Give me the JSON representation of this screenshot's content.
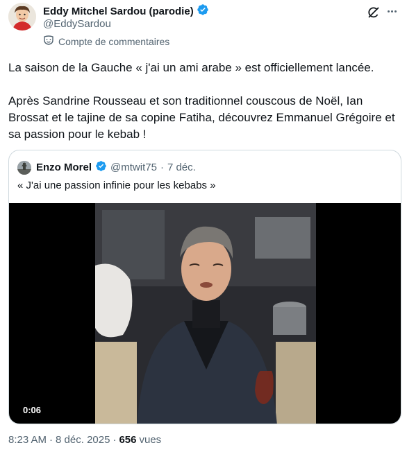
{
  "author": {
    "display_name": "Eddy Mitchel Sardou (parodie)",
    "handle": "@EddySardou",
    "account_label": "Compte de commentaires",
    "verified": true
  },
  "tweet": {
    "paragraphs": [
      "La saison de la Gauche « j'ai un ami arabe » est officiellement lancée.",
      "Après Sandrine Rousseau et son traditionnel couscous de Noël, Ian Brossat et le tajine de sa copine Fatiha, découvrez Emmanuel Grégoire et sa passion pour le kebab !"
    ],
    "time": "8:23 AM",
    "separator": "·",
    "date": "8 déc. 2025",
    "views_count": "656",
    "views_label": "vues"
  },
  "quote": {
    "display_name": "Enzo Morel",
    "handle": "@mtwit75",
    "separator": "·",
    "date": "7 déc.",
    "text": "« J'ai une passion infinie pour les kebabs »",
    "video_time": "0:06"
  },
  "colors": {
    "verified_blue": "#1d9bf0",
    "text_primary": "#0f1419",
    "text_secondary": "#536471",
    "border": "#cfd9de"
  },
  "icons": {
    "verified": "verified-badge-icon",
    "grok": "grok-icon",
    "more": "more-icon",
    "label": "theater-masks-icon"
  }
}
